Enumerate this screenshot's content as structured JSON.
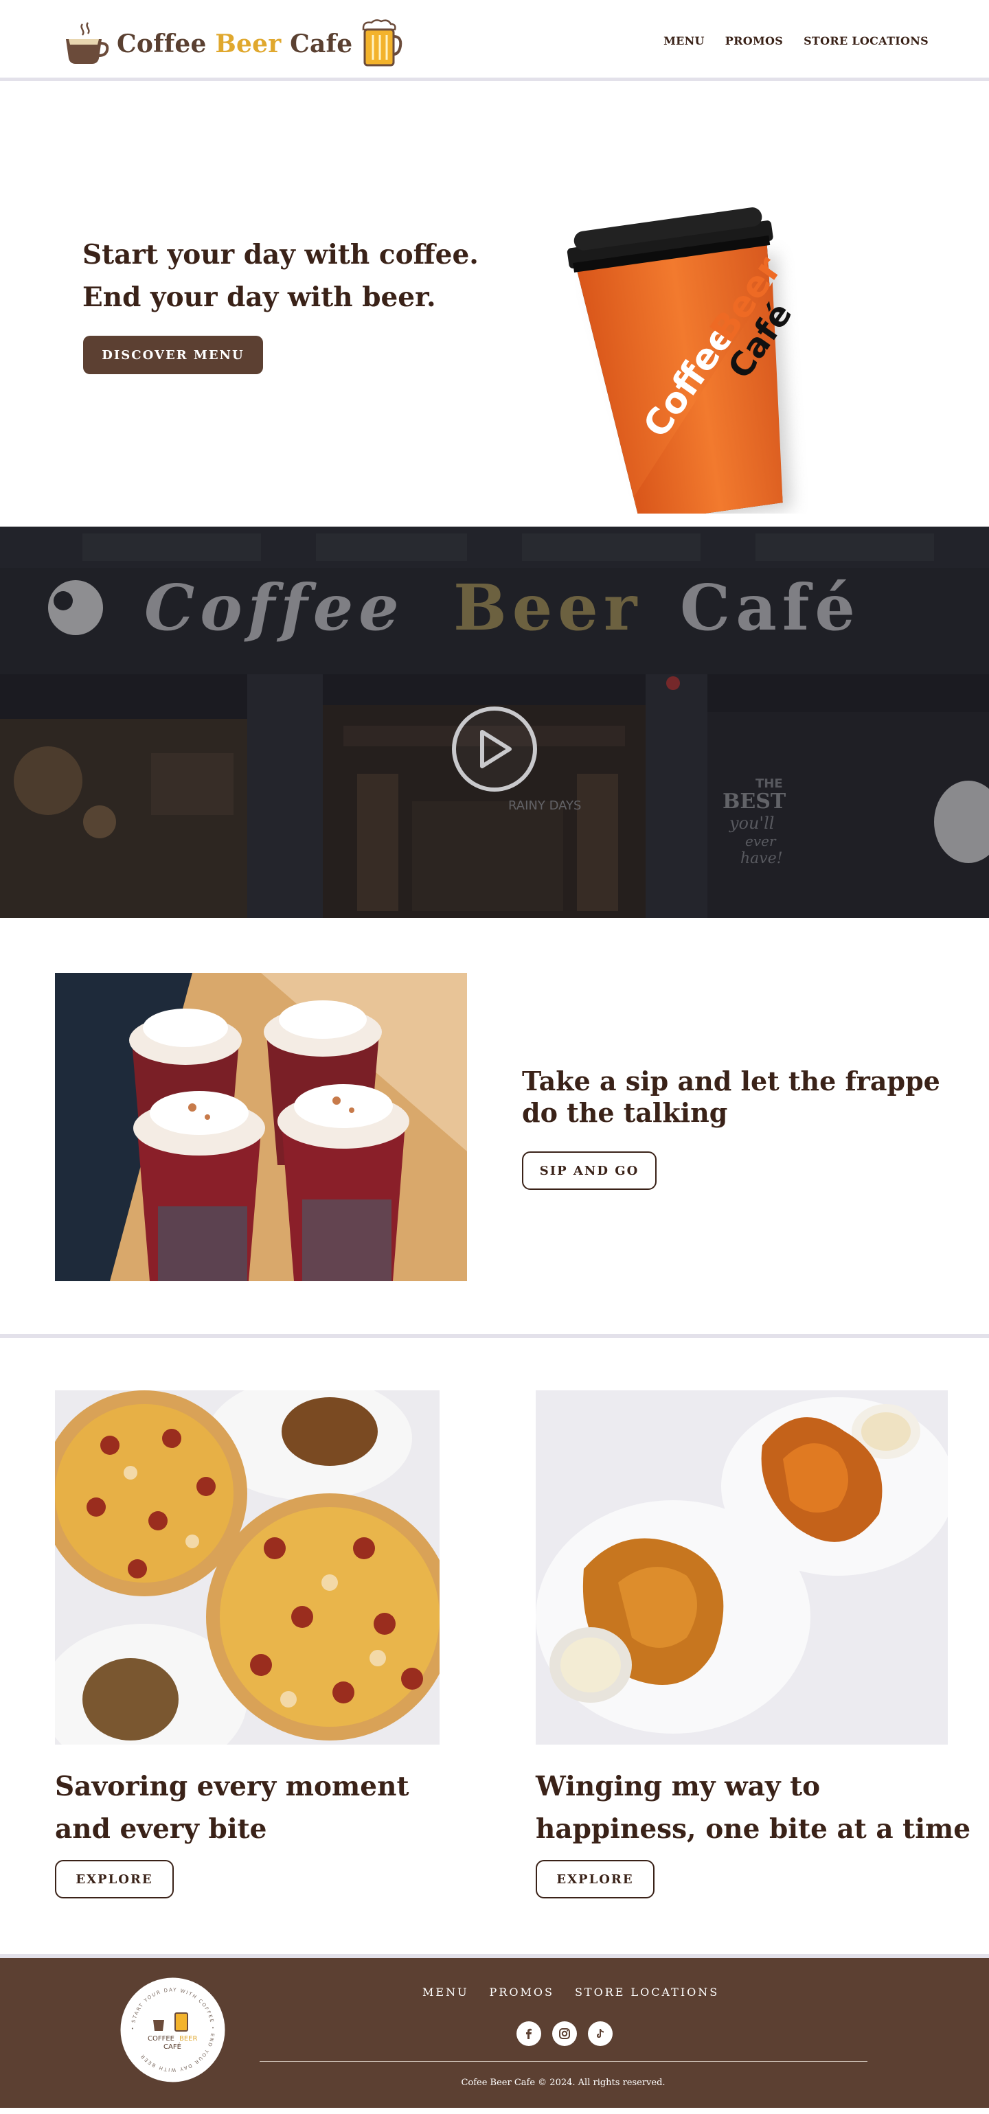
{
  "header": {
    "logo": {
      "pre": "Coffee ",
      "accent": "Beer",
      "post": " Cafe"
    },
    "nav": [
      "MENU",
      "PROMOS",
      "STORE LOCATIONS"
    ]
  },
  "hero": {
    "line1": "Start your day with coffee.",
    "line2": "End your day with beer.",
    "cta": "DISCOVER  MENU",
    "cup_text": {
      "word1": "Coffee",
      "word2": "Beer",
      "word3": "Café"
    }
  },
  "video": {
    "sign": {
      "word1": "Coffee",
      "word2": "Beer",
      "word3": "Café"
    },
    "window_text": {
      "l1": "THE",
      "l2": "BEST",
      "l3": "you'll",
      "l4": "ever",
      "l5": "have!"
    },
    "rainy": "RAINY DAYS",
    "colors": {
      "accent": "#e0a82e",
      "overlay": "#1c1d23"
    }
  },
  "frappe": {
    "title": "Take a sip and let the frappe do the talking",
    "cta": "SIP AND GO"
  },
  "food": [
    {
      "title": "Savoring every moment and every bite",
      "cta": "EXPLORE"
    },
    {
      "title": "Winging my way to happiness, one bite at a time",
      "cta": "EXPLORE"
    }
  ],
  "footer": {
    "logo": {
      "ring": "• START YOUR DAY WITH COFFEE • END YOUR DAY WITH BEER",
      "line1": "COFFEE",
      "line1b": "BEER",
      "line2": "CAFÉ"
    },
    "nav": [
      "MENU",
      "PROMOS",
      "STORE LOCATIONS"
    ],
    "socials": [
      "facebook-icon",
      "instagram-icon",
      "tiktok-icon"
    ],
    "copyright": "Cofee Beer Cafe © 2024. All rights reserved."
  },
  "colors": {
    "brown": "#5c4032",
    "text": "#3a2218",
    "gold": "#e0a82e",
    "orange": "#ee6a24",
    "divider": "#e3e1ea"
  }
}
